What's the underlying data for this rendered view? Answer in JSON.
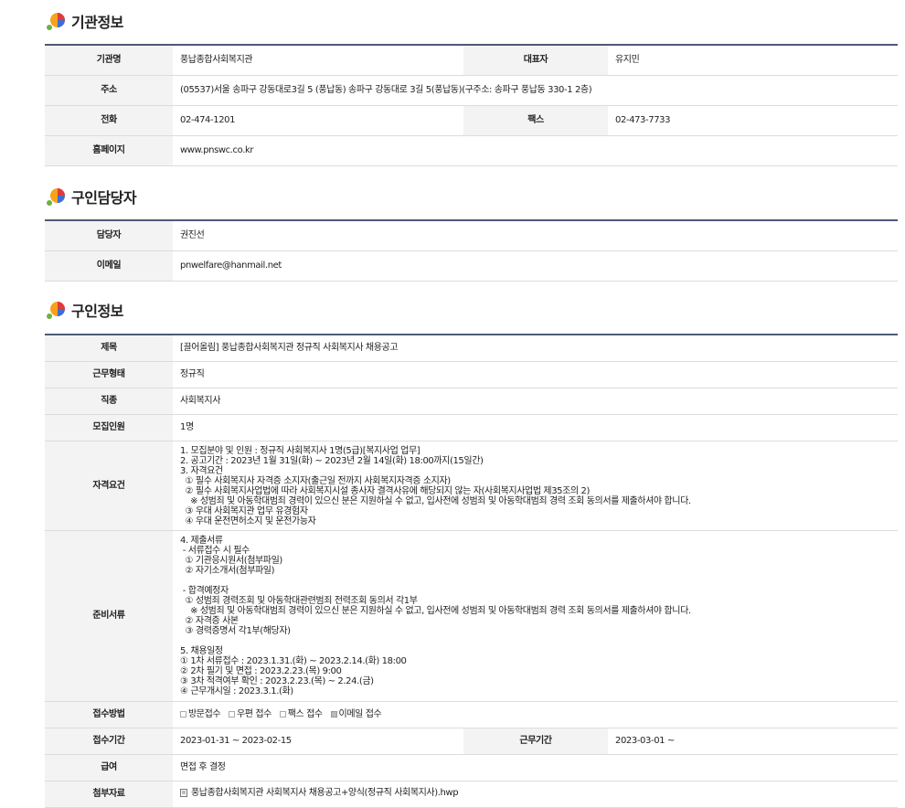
{
  "org": {
    "title": "기관정보",
    "name_label": "기관명",
    "name": "풍납종합사회복지관",
    "rep_label": "대표자",
    "rep": "유지민",
    "addr_label": "주소",
    "addr": "(05537)서울 송파구 강동대로3길 5 (풍납동) 송파구 강동대로 3길 5(풍납동)(구주소: 송파구 풍납동 330-1 2층)",
    "tel_label": "전화",
    "tel": "02-474-1201",
    "fax_label": "팩스",
    "fax": "02-473-7733",
    "home_label": "홈페이지",
    "home": "www.pnswc.co.kr"
  },
  "contact": {
    "title": "구인담당자",
    "person_label": "담당자",
    "person": "권진선",
    "email_label": "이메일",
    "email": "pnwelfare@hanmail.net"
  },
  "job": {
    "title": "구인정보",
    "subject_label": "제목",
    "subject": "[끌어올림] 풍납종합사회복지관 정규직 사회복지사 채용공고",
    "type_label": "근무형태",
    "type": "정규직",
    "field_label": "직종",
    "field": "사회복지사",
    "count_label": "모집인원",
    "count": "1명",
    "qual_label": "자격요건",
    "qual": "1. 모집분야 및 인원 : 정규직 사회복지사 1명(5급)[복지사업 업무]\n2. 공고기간 : 2023년 1월 31일(화) ~ 2023년 2월 14일(화) 18:00까지(15일간)\n3. 자격요건\n  ① 필수 사회복지사 자격증 소지자(출근일 전까지 사회복지자격증 소지자)\n  ② 필수 사회복지사업법에 따라 사회복지시설 종사자 결격사유에 해당되지 않는 자(사회복지사업법 제35조의 2)\n    ※ 성범죄 및 아동학대범죄 경력이 있으신 분은 지원하실 수 없고, 입사전에 성범죄 및 아동학대범죄 경력 조회 동의서를 제출하셔야 합니다.\n  ③ 우대 사회복지관 업무 유경험자\n  ④ 우대 운전면허소지 및 운전가능자",
    "docs_label": "준비서류",
    "docs": "4. 제출서류\n - 서류접수 시 필수\n  ① 기관응시원서(첨부파일)\n  ② 자기소개서(첨부파일)\n\n - 합격예정자\n  ① 성범죄 경력조회 및 아동학대관련범죄 전력조회 동의서 각1부\n    ※ 성범죄 및 아동학대범죄 경력이 있으신 분은 지원하실 수 없고, 입사전에 성범죄 및 아동학대범죄 경력 조회 동의서를 제출하셔야 합니다.\n  ② 자격증 사본\n  ③ 경력증명서 각1부(해당자)\n\n5. 채용일정\n① 1차 서류접수 : 2023.1.31.(화) ~ 2023.2.14.(화) 18:00\n② 2차 필기 및 면접 : 2023.2.23.(목) 9:00\n③ 3차 적격여부 확인 : 2023.2.23.(목) ~ 2.24.(금)\n④ 근무개시일 : 2023.3.1.(화)",
    "method_label": "접수방법",
    "methods": [
      {
        "label": "방문접수",
        "checked": false
      },
      {
        "label": "우편 접수",
        "checked": false
      },
      {
        "label": "팩스 접수",
        "checked": false
      },
      {
        "label": "이메일 접수",
        "checked": true
      }
    ],
    "period_label": "접수기간",
    "period": "2023-01-31 ~ 2023-02-15",
    "work_period_label": "근무기간",
    "work_period": "2023-03-01 ~",
    "salary_label": "급여",
    "salary": "면접 후 결정",
    "attach_label": "첨부자료",
    "attach": "풍납종합사회복지관 사회복지사 채용공고+양식(정규직 사회복지사).hwp"
  }
}
